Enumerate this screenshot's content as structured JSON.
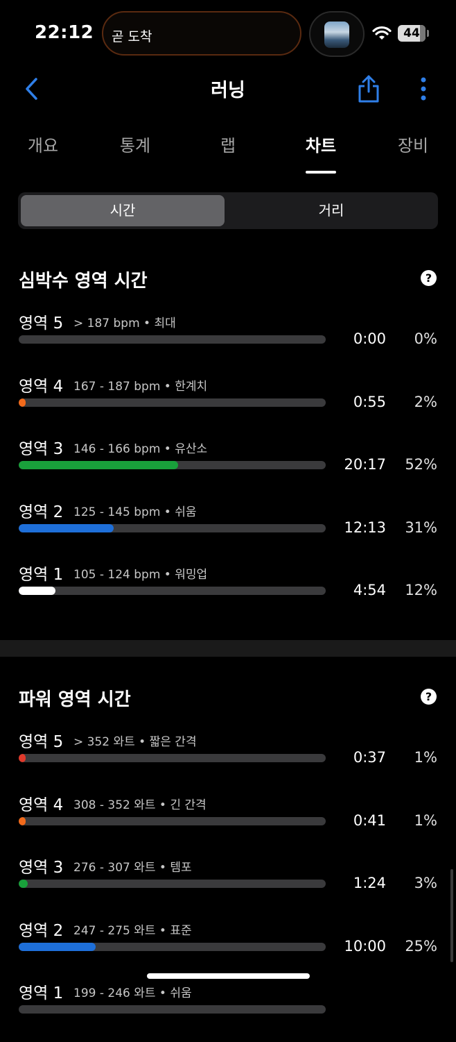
{
  "status_bar": {
    "time": "22:12",
    "island_text": "곧 도착",
    "battery": "44"
  },
  "nav": {
    "title": "러닝"
  },
  "tabs": [
    {
      "label": "개요"
    },
    {
      "label": "통계"
    },
    {
      "label": "랩"
    },
    {
      "label": "차트",
      "active": true
    },
    {
      "label": "장비"
    }
  ],
  "segmented": {
    "selected": "시간",
    "other": "거리"
  },
  "heart_zones": {
    "title": "심박수 영역 시간",
    "help": "?",
    "zones": [
      {
        "name": "영역 5",
        "range": "> 187 bpm • 최대",
        "time": "0:00",
        "pct": "0%",
        "fraction": 0.0,
        "color": "#e0392b"
      },
      {
        "name": "영역 4",
        "range": "167 - 187 bpm • 한계치",
        "time": "0:55",
        "pct": "2%",
        "fraction": 0.02,
        "color": "#f26a1b"
      },
      {
        "name": "영역 3",
        "range": "146 - 166 bpm • 유산소",
        "time": "20:17",
        "pct": "52%",
        "fraction": 0.52,
        "color": "#19a03b"
      },
      {
        "name": "영역 2",
        "range": "125 - 145 bpm • 쉬움",
        "time": "12:13",
        "pct": "31%",
        "fraction": 0.31,
        "color": "#1e6fd9"
      },
      {
        "name": "영역 1",
        "range": "105 - 124 bpm • 워밍업",
        "time": "4:54",
        "pct": "12%",
        "fraction": 0.12,
        "color": "#ffffff"
      }
    ]
  },
  "power_zones": {
    "title": "파워 영역 시간",
    "help": "?",
    "zones": [
      {
        "name": "영역 5",
        "range": "> 352 와트 • 짧은 간격",
        "time": "0:37",
        "pct": "1%",
        "fraction": 0.01,
        "color": "#e0392b"
      },
      {
        "name": "영역 4",
        "range": "308 - 352 와트 • 긴 간격",
        "time": "0:41",
        "pct": "1%",
        "fraction": 0.01,
        "color": "#f26a1b"
      },
      {
        "name": "영역 3",
        "range": "276 - 307 와트 • 템포",
        "time": "1:24",
        "pct": "3%",
        "fraction": 0.03,
        "color": "#19a03b"
      },
      {
        "name": "영역 2",
        "range": "247 - 275 와트 • 표준",
        "time": "10:00",
        "pct": "25%",
        "fraction": 0.25,
        "color": "#1e6fd9"
      },
      {
        "name": "영역 1",
        "range": "199 - 246 와트 • 쉬움",
        "time": "",
        "pct": "",
        "fraction": 0.0,
        "color": "#ffffff"
      }
    ]
  }
}
